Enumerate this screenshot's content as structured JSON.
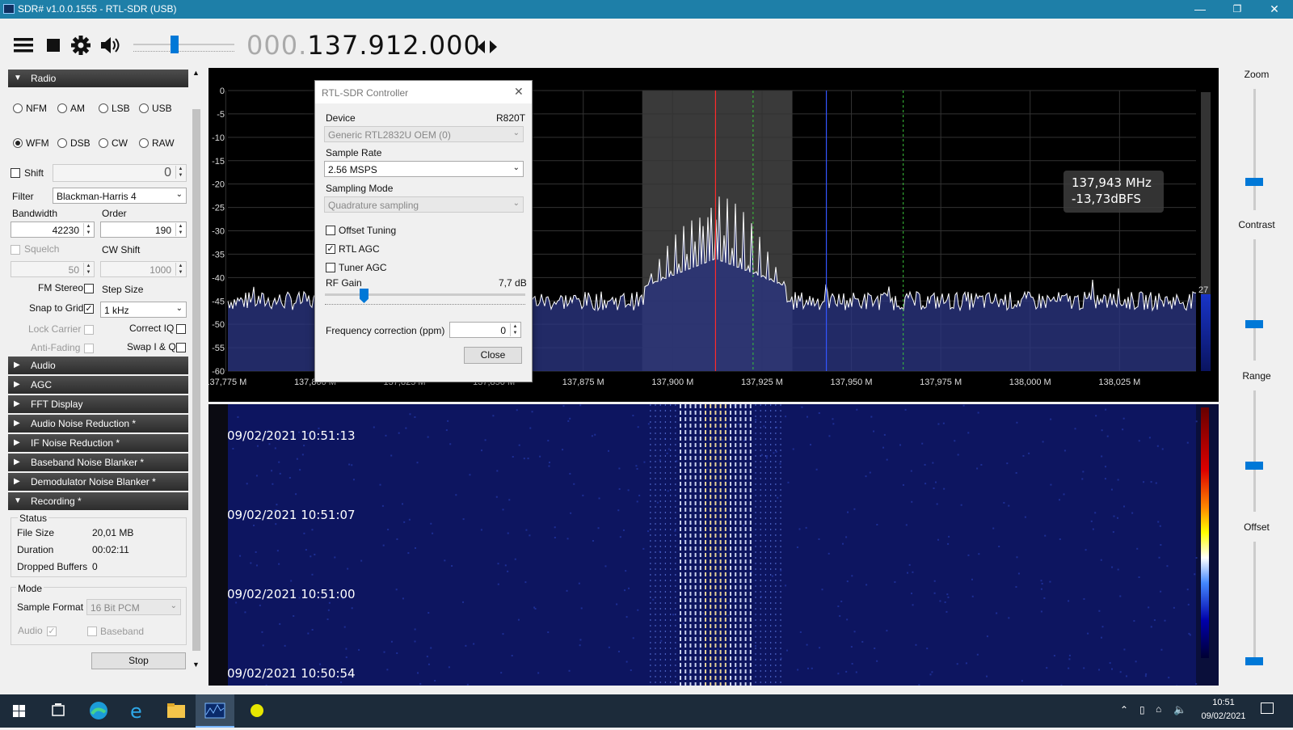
{
  "window": {
    "title": "SDR# v1.0.0.1555 - RTL-SDR (USB)",
    "min_glyph": "—",
    "max_glyph": "❐",
    "close_glyph": "✕"
  },
  "toolbar": {
    "freq_dim": "000.",
    "freq_main": "137.912.000",
    "icons": [
      "menu-icon",
      "stop-icon",
      "gear-icon",
      "speaker-icon",
      "tune-arrows-icon"
    ],
    "volume_level": 0.4
  },
  "radio": {
    "header": "Radio",
    "modes": [
      {
        "label": "NFM",
        "selected": false
      },
      {
        "label": "AM",
        "selected": false
      },
      {
        "label": "LSB",
        "selected": false
      },
      {
        "label": "USB",
        "selected": false
      },
      {
        "label": "WFM",
        "selected": true
      },
      {
        "label": "DSB",
        "selected": false
      },
      {
        "label": "CW",
        "selected": false
      },
      {
        "label": "RAW",
        "selected": false
      }
    ],
    "shift_label": "Shift",
    "shift_value": "0",
    "filter_label": "Filter",
    "filter_value": "Blackman-Harris 4",
    "bandwidth_label": "Bandwidth",
    "bandwidth_value": "42230",
    "order_label": "Order",
    "order_value": "190",
    "squelch_label": "Squelch",
    "squelch_value": "50",
    "cwshift_label": "CW Shift",
    "cwshift_value": "1000",
    "fmstereo_label": "FM Stereo",
    "stepsize_label": "Step Size",
    "snap_label": "Snap to Grid",
    "snap_checked": "✓",
    "step_value": "1 kHz",
    "lockcarrier_label": "Lock Carrier",
    "correctiq_label": "Correct IQ",
    "antifading_label": "Anti-Fading",
    "swapiq_label": "Swap I & Q"
  },
  "sections": [
    "Audio",
    "AGC",
    "FFT Display",
    "Audio Noise Reduction *",
    "IF Noise Reduction *",
    "Baseband Noise Blanker *",
    "Demodulator Noise Blanker *"
  ],
  "recording": {
    "header": "Recording *",
    "status_label": "Status",
    "filesize_label": "File Size",
    "filesize_value": "20,01 MB",
    "duration_label": "Duration",
    "duration_value": "00:02:11",
    "dropped_label": "Dropped Buffers",
    "dropped_value": "0",
    "mode_label": "Mode",
    "sampleformat_label": "Sample Format",
    "sampleformat_value": "16 Bit PCM",
    "audio_label": "Audio",
    "audio_checked": "✓",
    "baseband_label": "Baseband",
    "stop_label": "Stop"
  },
  "spectrum": {
    "y_ticks": [
      "0",
      "-5",
      "-10",
      "-15",
      "-20",
      "-25",
      "-30",
      "-35",
      "-40",
      "-45",
      "-50",
      "-55",
      "-60"
    ],
    "x_ticks": [
      "137,775 M",
      "137,800 M",
      "137,825 M",
      "137,850 M",
      "137,875 M",
      "137,900 M",
      "137,925 M",
      "137,950 M",
      "137,975 M",
      "138,000 M",
      "138,025 M"
    ],
    "tooltip_freq": "137,943 MHz",
    "tooltip_level": "-13,73dBFS",
    "side_value": "27",
    "band_start_mhz": 137.8915,
    "band_end_mhz": 137.9335,
    "center_mhz": 137.912,
    "cursor_mhz": 137.943,
    "green_mhz": [
      137.9225,
      137.9645
    ],
    "colors": {
      "band": "#3a3a3a",
      "center": "#ff2a2a",
      "cursor": "#3355ff",
      "green": "#3ac43a",
      "trace": "#ffffff",
      "fill": "#2a3580"
    }
  },
  "waterfall": {
    "timestamps": [
      "09/02/2021 10:51:13",
      "09/02/2021 10:51:07",
      "09/02/2021 10:51:00",
      "09/02/2021 10:50:54"
    ]
  },
  "right_panel": {
    "zoom_label": "Zoom",
    "contrast_label": "Contrast",
    "range_label": "Range",
    "offset_label": "Offset"
  },
  "dialog": {
    "title": "RTL-SDR Controller",
    "close_glyph": "✕",
    "device_label": "Device",
    "device_tuner": "R820T",
    "device_value": "Generic RTL2832U OEM (0)",
    "samplerate_label": "Sample Rate",
    "samplerate_value": "2.56 MSPS",
    "samplingmode_label": "Sampling Mode",
    "samplingmode_value": "Quadrature sampling",
    "offset_label": "Offset Tuning",
    "rtlagc_label": "RTL AGC",
    "rtlagc_checked": "✓",
    "tuneragc_label": "Tuner AGC",
    "rfgain_label": "RF Gain",
    "rfgain_value": "7,7 dB",
    "rfgain_level": 0.18,
    "freqcorr_label": "Frequency correction (ppm)",
    "freqcorr_value": "0",
    "close_label": "Close"
  },
  "taskbar": {
    "time": "10:51",
    "date": "09/02/2021",
    "apps": [
      "windows-start-icon",
      "task-view-icon",
      "edge-icon",
      "ie-icon",
      "file-explorer-icon",
      "sdrsharp-icon",
      "app-yellow-icon"
    ]
  }
}
